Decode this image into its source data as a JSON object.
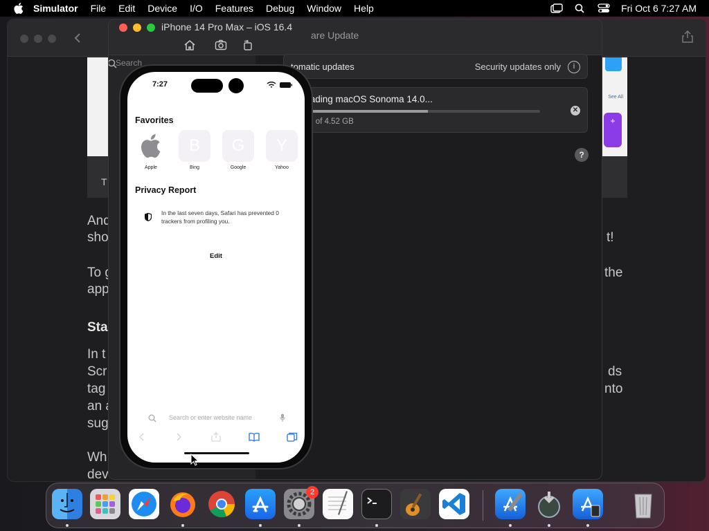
{
  "menubar": {
    "app_name": "Simulator",
    "items": [
      "File",
      "Edit",
      "Device",
      "I/O",
      "Features",
      "Debug",
      "Window",
      "Help"
    ],
    "clock": "Fri Oct 6  7:27 AM"
  },
  "background_article": {
    "fragments": [
      "And",
      "sho",
      "To g",
      "app",
      "Sta",
      "In t",
      "Scr",
      "tag",
      "an a",
      "sug",
      "Wh",
      "dev",
      "t!",
      "the",
      "ds",
      "nto",
      "T"
    ]
  },
  "simulator": {
    "window_title": "iPhone 14 Pro Max – iOS 16.4",
    "sidebar_search": "Search",
    "software_update": {
      "header": "are Update",
      "auto_updates_label": "tomatic updates",
      "security_label": "Security updates only",
      "download_title": "wnloading macOS Sonoma 14.0...",
      "download_progress": 0.55,
      "download_size": "52 GB of 4.52 GB"
    }
  },
  "phone": {
    "time": "7:27",
    "favorites_title": "Favorites",
    "favorites": [
      {
        "label": "Apple",
        "letter": ""
      },
      {
        "label": "Bing",
        "letter": "B"
      },
      {
        "label": "Google",
        "letter": "G"
      },
      {
        "label": "Yahoo",
        "letter": "Y"
      }
    ],
    "privacy_title": "Privacy Report",
    "privacy_text": "In the last seven days, Safari has prevented 0 trackers from profiling you.",
    "edit_label": "Edit",
    "address_placeholder": "Search or enter website name"
  },
  "dock": {
    "apps": [
      "finder",
      "launchpad",
      "safari",
      "firefox",
      "chrome",
      "app-store",
      "system-settings",
      "textedit",
      "terminal",
      "garageband",
      "vscode",
      "xcode",
      "migration-assistant",
      "simulator",
      "trash"
    ],
    "settings_badge": "2"
  },
  "colors": {
    "traffic_red": "#ff5f57",
    "traffic_yellow": "#febc2e",
    "traffic_green": "#28c840"
  }
}
